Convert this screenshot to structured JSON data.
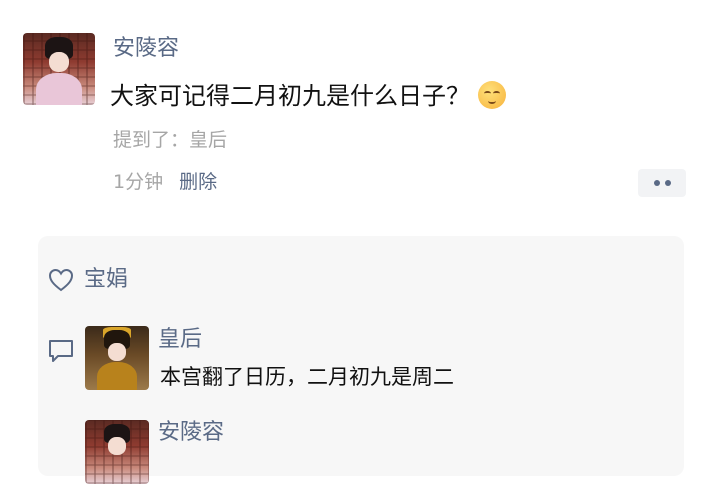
{
  "post": {
    "author": "安陵容",
    "text": "大家可记得二月初九是什么日子？",
    "emoji": "smile-emoji",
    "mention": "提到了：皇后",
    "time": "1分钟",
    "delete_label": "删除"
  },
  "likes": {
    "names": "宝娟"
  },
  "comments": [
    {
      "author": "皇后",
      "text": "本宫翻了日历，二月初九是周二"
    },
    {
      "author": "安陵容",
      "text": ""
    }
  ],
  "colors": {
    "name": "#5a6a86",
    "meta": "#a6a6a6",
    "panel": "#f7f7f7"
  }
}
